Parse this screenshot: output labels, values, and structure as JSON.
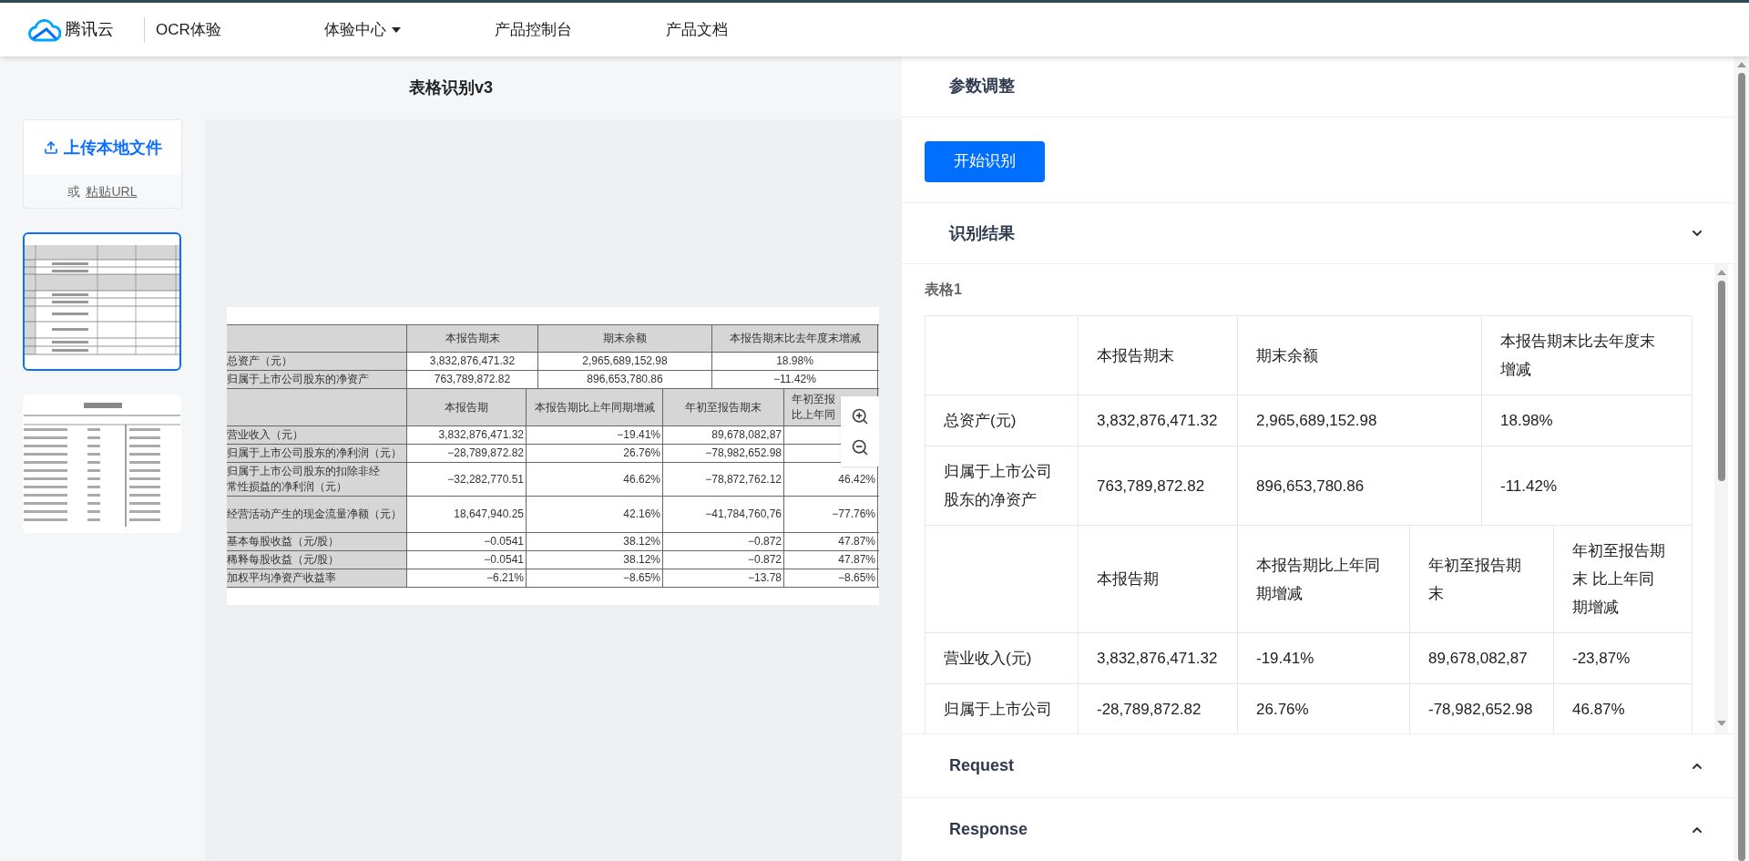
{
  "header": {
    "brand": "腾讯云",
    "product": "OCR体验",
    "nav": [
      {
        "label": "体验中心",
        "dropdown": true
      },
      {
        "label": "产品控制台",
        "dropdown": false
      },
      {
        "label": "产品文档",
        "dropdown": false
      }
    ]
  },
  "demo": {
    "title": "表格识别v3",
    "upload": {
      "label": "上传本地文件",
      "alt_prefix": "或",
      "alt_link": "粘贴URL"
    },
    "thumbnails": [
      {
        "kind": "table",
        "selected": true
      },
      {
        "kind": "report",
        "selected": false
      }
    ],
    "document": {
      "sections": [
        {
          "header": [
            "本报告期末",
            "期末余额",
            "本报告期末比去年度末增减"
          ],
          "rows": [
            [
              "总资产（元）",
              "3,832,876,471.32",
              "2,965,689,152.98",
              "18.98%"
            ],
            [
              "归属于上市公司股东的净资产",
              "763,789,872.82",
              "896,653,780.86",
              "−11.42%"
            ]
          ]
        },
        {
          "header": [
            "本报告期",
            "本报告期比上年同期增减",
            "年初至报告期末",
            [
              "年初至报",
              "比上年同"
            ]
          ],
          "rows": [
            [
              "营业收入（元）",
              "3,832,876,471.32",
              "−19.41%",
              "89,678,082,87"
            ],
            [
              "归属于上市公司股东的净利润（元）",
              "−28,789,872.82",
              "26.76%",
              "−78,982,652.98"
            ],
            [
              [
                "归属于上市公司股东的扣除非经",
                "常性损益的净利润（元）"
              ],
              "−32,282,770.51",
              "46.62%",
              "−78,872,762.12",
              "46.42%"
            ],
            [
              "经营活动产生的现金流量净额（元）",
              "18,647,940.25",
              "42.16%",
              "−41,784,760,76",
              "−77.76%"
            ],
            [
              "基本每股收益（元/股）",
              "−0.0541",
              "38.12%",
              "−0.872",
              "47.87%"
            ],
            [
              "稀释每股收益（元/股）",
              "−0.0541",
              "38.12%",
              "−0.872",
              "47.87%"
            ],
            [
              "加权平均净资产收益率",
              "−6.21%",
              "−8.65%",
              "−13.78",
              "−8.65%"
            ]
          ]
        }
      ]
    }
  },
  "params": {
    "title": "参数调整",
    "button": "开始识别"
  },
  "results": {
    "title": "识别结果",
    "expanded": true,
    "table_title": "表格1",
    "sections": [
      {
        "header": [
          "本报告期末",
          "期末余额",
          "本报告期末比去年度末增减"
        ],
        "rows": [
          [
            "总资产(元)",
            "3,832,876,471.32",
            "2,965,689,152.98",
            "18.98%"
          ],
          [
            "归属于上市公司股东的净资产",
            "763,789,872.82",
            "896,653,780.86",
            "-11.42%"
          ]
        ]
      },
      {
        "header": [
          "本报告期",
          "本报告期比上年同期增减",
          "年初至报告期末",
          "年初至报告期末 比上年同期增减"
        ],
        "rows": [
          [
            "营业收入(元)",
            "3,832,876,471.32",
            "-19.41%",
            "89,678,082,87",
            "-23,87%"
          ],
          [
            "归属于上市公司",
            "-28,789,872.82",
            "26.76%",
            "-78,982,652.98",
            "46.87%"
          ]
        ]
      }
    ]
  },
  "request": {
    "title": "Request",
    "expanded": false
  },
  "response": {
    "title": "Response",
    "expanded": false
  }
}
